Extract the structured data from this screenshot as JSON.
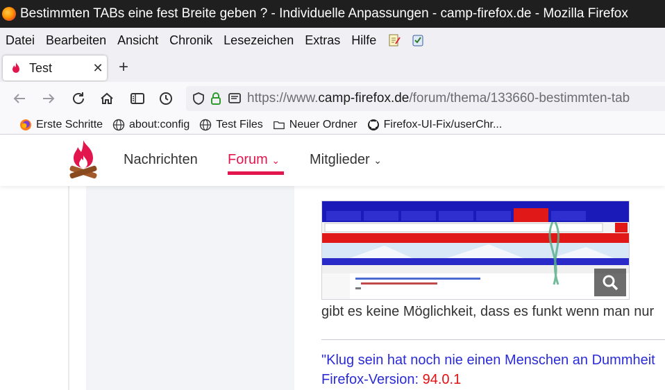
{
  "window": {
    "title": "Bestimmten TABs eine fest Breite geben ? - Individuelle Anpassungen - camp-firefox.de - Mozilla Firefox"
  },
  "menubar": {
    "items": [
      "Datei",
      "Bearbeiten",
      "Ansicht",
      "Chronik",
      "Lesezeichen",
      "Extras",
      "Hilfe"
    ]
  },
  "tabs": [
    {
      "label": "Test"
    }
  ],
  "urlbar": {
    "prefix": "https://www.",
    "host": "camp-firefox.de",
    "path": "/forum/thema/133660-bestimmten-tab"
  },
  "bookmarks": [
    {
      "label": "Erste Schritte",
      "icon": "firefox-icon"
    },
    {
      "label": "about:config",
      "icon": "globe-icon"
    },
    {
      "label": "Test Files",
      "icon": "globe-icon"
    },
    {
      "label": "Neuer Ordner",
      "icon": "folder-icon"
    },
    {
      "label": "Firefox-UI-Fix/userChr...",
      "icon": "github-icon"
    }
  ],
  "site_nav": {
    "items": [
      "Nachrichten",
      "Forum",
      "Mitglieder"
    ],
    "active": "Forum"
  },
  "post": {
    "text": "gibt es keine Möglichkeit, dass es funkt wenn man nur",
    "quote": "\"Klug sein hat noch nie einen Menschen an Dummheit",
    "version_label": "Firefox-Version:",
    "version_value": "94.0.1"
  },
  "colors": {
    "accent": "#e2154d",
    "quote": "#2b2bd6",
    "version": "#e21010",
    "titlebar": "#1f1f1f"
  }
}
